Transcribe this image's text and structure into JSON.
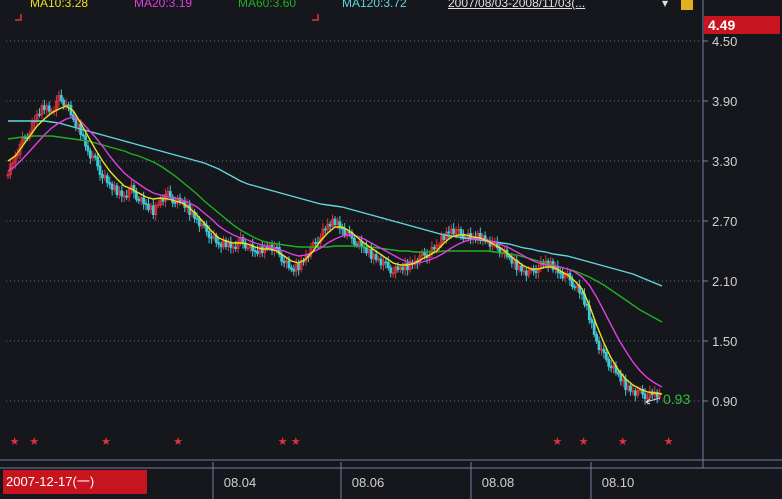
{
  "legend": [
    {
      "label": "MA10:3.28",
      "color": "#f0e020"
    },
    {
      "label": "MA20:3.19",
      "color": "#e040e0"
    },
    {
      "label": "MA60:3.60",
      "color": "#20b020"
    },
    {
      "label": "MA120:3.72",
      "color": "#60d8e0"
    },
    {
      "label": "2007/08/03-2008/11/03(...",
      "color": "#e0e0e0"
    }
  ],
  "current_price": "4.49",
  "cursor_date": "2007-12-17(一)",
  "last_label": "0.93",
  "colors": {
    "background": "#15171c",
    "up": "#e0323c",
    "down": "#40c8d8",
    "ma_short": "#f0e020",
    "ma_mid": "#e040e0",
    "ma_long": "#20b020",
    "ma_longest": "#60d8e0",
    "grid": "#5a6a8a",
    "accent": "#c8141e",
    "last_label": "#30c030"
  },
  "chart_data": {
    "type": "candlestick",
    "title": "",
    "xlabel": "",
    "ylabel": "",
    "ylim": [
      0.6,
      4.55
    ],
    "y_ticks": [
      0.9,
      1.5,
      2.1,
      2.7,
      3.3,
      3.9,
      4.5
    ],
    "y_tick_labels": [
      "0.90",
      "1.50",
      "2.10",
      "2.70",
      "3.30",
      "3.90",
      "4.50"
    ],
    "x_ticks": [
      "08.04",
      "08.06",
      "08.08",
      "08.10"
    ],
    "x_range": [
      "2007-12-17",
      "2008-11-03"
    ],
    "grid": true,
    "close": [
      3.2,
      3.35,
      3.5,
      3.6,
      3.75,
      3.85,
      3.8,
      3.92,
      3.88,
      3.7,
      3.6,
      3.4,
      3.3,
      3.15,
      3.05,
      3.0,
      2.95,
      3.02,
      2.92,
      2.85,
      2.8,
      2.92,
      2.96,
      2.9,
      2.88,
      2.8,
      2.72,
      2.62,
      2.55,
      2.45,
      2.48,
      2.44,
      2.5,
      2.45,
      2.38,
      2.42,
      2.46,
      2.4,
      2.3,
      2.2,
      2.25,
      2.35,
      2.45,
      2.55,
      2.65,
      2.7,
      2.62,
      2.55,
      2.48,
      2.42,
      2.36,
      2.32,
      2.25,
      2.2,
      2.22,
      2.25,
      2.3,
      2.35,
      2.38,
      2.44,
      2.55,
      2.62,
      2.58,
      2.55,
      2.52,
      2.55,
      2.5,
      2.45,
      2.4,
      2.32,
      2.25,
      2.2,
      2.18,
      2.24,
      2.28,
      2.25,
      2.18,
      2.14,
      2.05,
      1.95,
      1.75,
      1.5,
      1.35,
      1.25,
      1.15,
      1.05,
      1.0,
      0.98,
      0.95,
      0.97,
      0.93
    ],
    "ma_short": {
      "name": "MA10",
      "values": [
        3.3,
        3.35,
        3.45,
        3.55,
        3.65,
        3.72,
        3.78,
        3.82,
        3.85,
        3.8,
        3.68,
        3.55,
        3.42,
        3.3,
        3.2,
        3.12,
        3.05,
        3.02,
        2.98,
        2.94,
        2.92,
        2.93,
        2.92,
        2.9,
        2.88,
        2.83,
        2.76,
        2.68,
        2.6,
        2.53,
        2.5,
        2.48,
        2.48,
        2.47,
        2.44,
        2.42,
        2.42,
        2.4,
        2.35,
        2.3,
        2.28,
        2.32,
        2.4,
        2.5,
        2.58,
        2.64,
        2.64,
        2.6,
        2.54,
        2.48,
        2.43,
        2.38,
        2.33,
        2.28,
        2.26,
        2.26,
        2.28,
        2.32,
        2.36,
        2.4,
        2.48,
        2.54,
        2.56,
        2.56,
        2.54,
        2.53,
        2.5,
        2.46,
        2.42,
        2.36,
        2.3,
        2.25,
        2.22,
        2.22,
        2.24,
        2.24,
        2.2,
        2.16,
        2.1,
        2.02,
        1.86,
        1.66,
        1.48,
        1.33,
        1.21,
        1.12,
        1.06,
        1.02,
        0.99,
        0.98,
        0.97
      ]
    },
    "ma_mid": {
      "name": "MA20",
      "values": [
        3.2,
        3.25,
        3.32,
        3.4,
        3.48,
        3.56,
        3.63,
        3.68,
        3.72,
        3.74,
        3.7,
        3.62,
        3.54,
        3.45,
        3.35,
        3.26,
        3.18,
        3.12,
        3.07,
        3.02,
        2.98,
        2.96,
        2.94,
        2.93,
        2.91,
        2.88,
        2.84,
        2.78,
        2.72,
        2.65,
        2.6,
        2.56,
        2.53,
        2.51,
        2.48,
        2.46,
        2.44,
        2.42,
        2.4,
        2.37,
        2.35,
        2.36,
        2.39,
        2.43,
        2.48,
        2.52,
        2.55,
        2.56,
        2.55,
        2.52,
        2.48,
        2.44,
        2.4,
        2.36,
        2.32,
        2.29,
        2.28,
        2.29,
        2.31,
        2.34,
        2.38,
        2.43,
        2.47,
        2.5,
        2.52,
        2.52,
        2.51,
        2.49,
        2.46,
        2.43,
        2.39,
        2.35,
        2.31,
        2.28,
        2.26,
        2.25,
        2.24,
        2.22,
        2.19,
        2.14,
        2.06,
        1.94,
        1.8,
        1.66,
        1.52,
        1.4,
        1.29,
        1.2,
        1.13,
        1.08,
        1.04
      ]
    },
    "ma_long": {
      "name": "MA60",
      "values": [
        3.52,
        3.53,
        3.54,
        3.55,
        3.55,
        3.55,
        3.55,
        3.54,
        3.53,
        3.52,
        3.51,
        3.5,
        3.48,
        3.46,
        3.44,
        3.42,
        3.4,
        3.37,
        3.35,
        3.32,
        3.29,
        3.25,
        3.2,
        3.15,
        3.09,
        3.03,
        2.97,
        2.9,
        2.84,
        2.78,
        2.72,
        2.66,
        2.61,
        2.57,
        2.53,
        2.5,
        2.48,
        2.47,
        2.46,
        2.45,
        2.44,
        2.44,
        2.44,
        2.44,
        2.44,
        2.45,
        2.45,
        2.45,
        2.45,
        2.44,
        2.44,
        2.43,
        2.42,
        2.41,
        2.4,
        2.4,
        2.39,
        2.39,
        2.39,
        2.39,
        2.4,
        2.4,
        2.4,
        2.4,
        2.4,
        2.4,
        2.4,
        2.39,
        2.38,
        2.37,
        2.36,
        2.34,
        2.32,
        2.3,
        2.28,
        2.26,
        2.24,
        2.22,
        2.2,
        2.17,
        2.14,
        2.1,
        2.06,
        2.01,
        1.96,
        1.91,
        1.86,
        1.81,
        1.77,
        1.73,
        1.69
      ]
    },
    "ma_longest": {
      "name": "MA120",
      "values": [
        3.7,
        3.7,
        3.7,
        3.7,
        3.7,
        3.7,
        3.69,
        3.68,
        3.66,
        3.64,
        3.62,
        3.6,
        3.58,
        3.56,
        3.54,
        3.52,
        3.5,
        3.48,
        3.46,
        3.44,
        3.42,
        3.4,
        3.38,
        3.36,
        3.34,
        3.32,
        3.3,
        3.28,
        3.25,
        3.22,
        3.18,
        3.14,
        3.1,
        3.07,
        3.05,
        3.03,
        3.01,
        2.99,
        2.97,
        2.95,
        2.93,
        2.91,
        2.89,
        2.87,
        2.86,
        2.85,
        2.84,
        2.82,
        2.8,
        2.78,
        2.76,
        2.74,
        2.72,
        2.7,
        2.68,
        2.66,
        2.64,
        2.62,
        2.6,
        2.58,
        2.56,
        2.55,
        2.54,
        2.53,
        2.52,
        2.51,
        2.5,
        2.49,
        2.48,
        2.47,
        2.45,
        2.43,
        2.42,
        2.4,
        2.39,
        2.37,
        2.36,
        2.35,
        2.33,
        2.31,
        2.29,
        2.27,
        2.25,
        2.23,
        2.21,
        2.19,
        2.17,
        2.14,
        2.11,
        2.08,
        2.05
      ]
    },
    "markers": [
      0.01,
      0.04,
      0.15,
      0.26,
      0.42,
      0.44,
      0.84,
      0.88,
      0.94,
      1.01
    ]
  }
}
